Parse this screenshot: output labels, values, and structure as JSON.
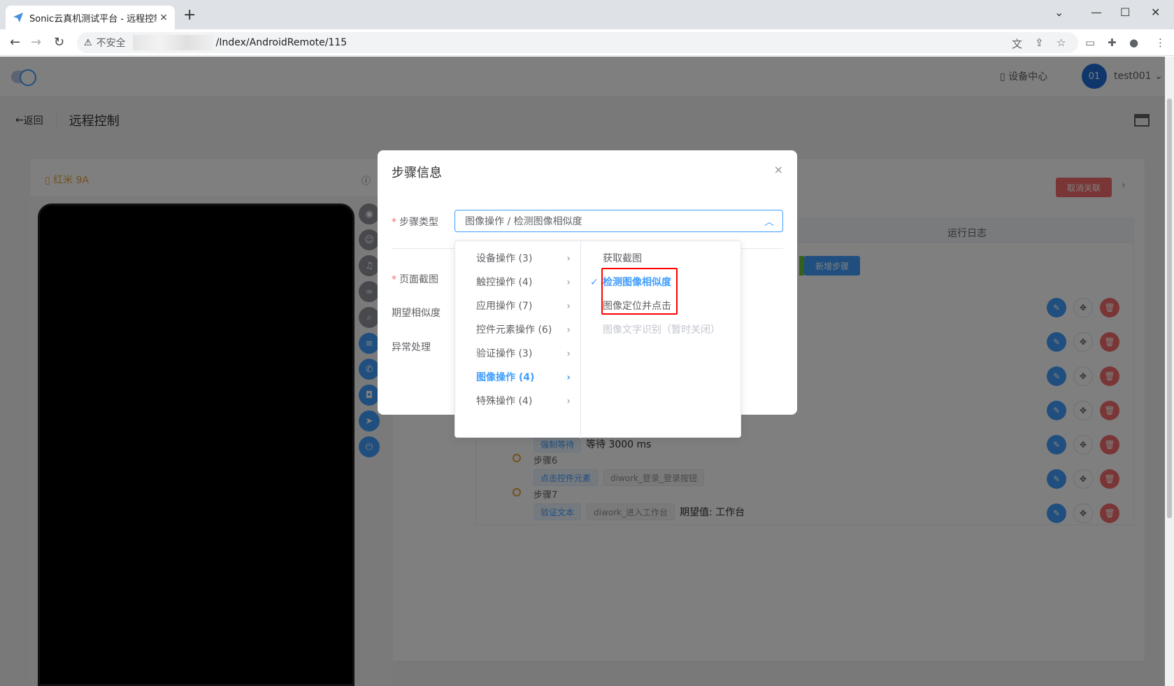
{
  "browser": {
    "tab_title": "Sonic云真机测试平台 - 远程控制",
    "tab_close": "×",
    "new_tab": "+",
    "security_label": "不安全",
    "url_path": "/Index/AndroidRemote/115"
  },
  "header": {
    "device_center": "设备中心",
    "avatar_text": "01",
    "username": "test001"
  },
  "page": {
    "back_label": "返回",
    "title": "远程控制"
  },
  "device": {
    "name": "红米 9A"
  },
  "right_panel": {
    "log_tab": "运行日志",
    "cancel_link": "取消关联",
    "add_step": "新增步骤",
    "steps": [
      {
        "tag": "强制等待",
        "text": "等待 3000 ms"
      },
      {
        "label": "步骤6",
        "tag": "点击控件元素",
        "value": "diwork_登录_登录按钮"
      },
      {
        "label": "步骤7",
        "tag": "验证文本",
        "value": "diwork_进入工作台",
        "expect": "期望值: 工作台"
      }
    ]
  },
  "dialog": {
    "title": "步骤信息",
    "close": "×",
    "step_type_label": "步骤类型",
    "step_type_value": "图像操作 / 检测图像相似度",
    "screenshot_label": "页面截图",
    "similarity_label": "期望相似度",
    "exception_label": "异常处理"
  },
  "cascader": {
    "level1": [
      {
        "label": "设备操作 (3)"
      },
      {
        "label": "触控操作 (4)"
      },
      {
        "label": "应用操作 (7)"
      },
      {
        "label": "控件元素操作 (6)"
      },
      {
        "label": "验证操作 (3)"
      },
      {
        "label": "图像操作 (4)"
      },
      {
        "label": "特殊操作 (4)"
      }
    ],
    "level2": [
      {
        "label": "获取截图"
      },
      {
        "label": "检测图像相似度"
      },
      {
        "label": "图像定位并点击"
      },
      {
        "label": "图像文字识别（暂时关闭）"
      }
    ]
  },
  "colors": {
    "primary": "#409eff",
    "danger": "#f56c6c",
    "warning": "#e6a23c",
    "highlight_box": "#ff0000"
  }
}
